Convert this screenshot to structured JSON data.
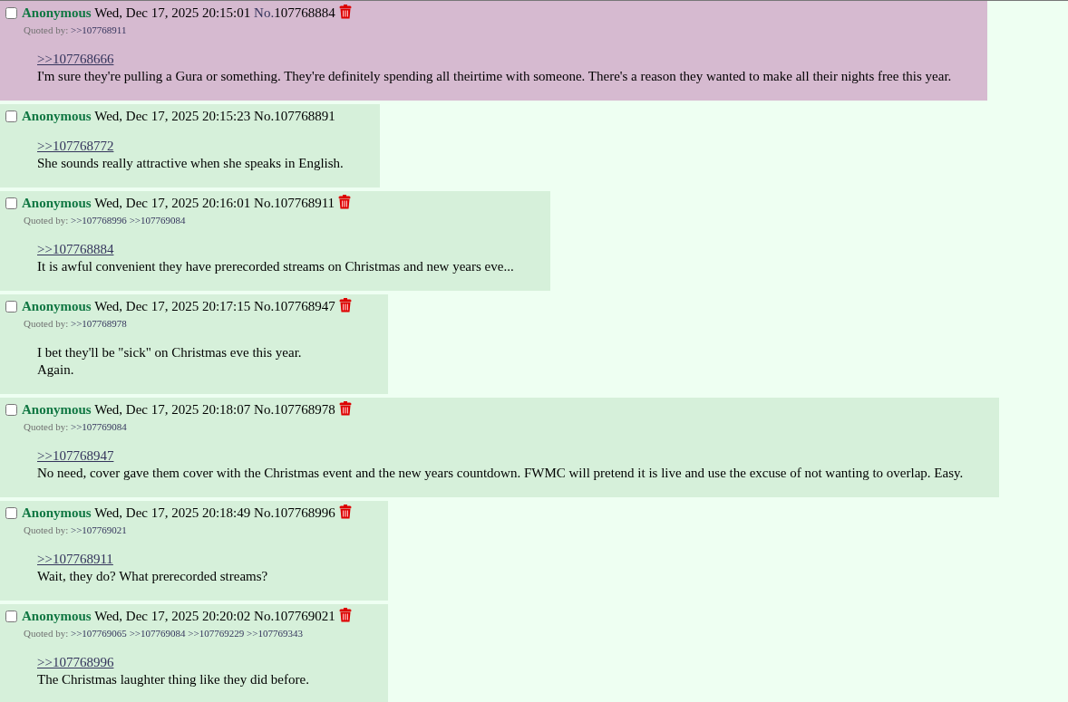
{
  "posts": [
    {
      "selected": false,
      "highlighted": true,
      "name": "Anonymous",
      "datetime": "Wed, Dec 17, 2025 20:15:01",
      "number_label": "No.",
      "number": "107768884",
      "deletable": true,
      "quoted_by_label": "Quoted by:",
      "quoted_by": [
        ">>107768911"
      ],
      "quote_link": ">>107768666",
      "lines": [
        "I'm sure they're pulling a Gura or something. They're definitely spending all theirtime with someone. There's a reason they wanted to make all their nights free this year."
      ]
    },
    {
      "selected": false,
      "highlighted": false,
      "name": "Anonymous",
      "datetime": "Wed, Dec 17, 2025 20:15:23",
      "number_label": "No.",
      "number": "107768891",
      "deletable": false,
      "quote_link": ">>107768772",
      "lines": [
        "She sounds really attractive when she speaks in English."
      ]
    },
    {
      "selected": false,
      "highlighted": false,
      "name": "Anonymous",
      "datetime": "Wed, Dec 17, 2025 20:16:01",
      "number_label": "No.",
      "number": "107768911",
      "deletable": true,
      "quoted_by_label": "Quoted by:",
      "quoted_by": [
        ">>107768996",
        ">>107769084"
      ],
      "quote_link": ">>107768884",
      "lines": [
        "It is awful convenient they have prerecorded streams on Christmas and new years eve..."
      ]
    },
    {
      "selected": false,
      "highlighted": false,
      "name": "Anonymous",
      "datetime": "Wed, Dec 17, 2025 20:17:15",
      "number_label": "No.",
      "number": "107768947",
      "deletable": true,
      "quoted_by_label": "Quoted by:",
      "quoted_by": [
        ">>107768978"
      ],
      "lines": [
        "I bet they'll be \"sick\" on Christmas eve this year.",
        "Again."
      ]
    },
    {
      "selected": false,
      "highlighted": false,
      "name": "Anonymous",
      "datetime": "Wed, Dec 17, 2025 20:18:07",
      "number_label": "No.",
      "number": "107768978",
      "deletable": true,
      "quoted_by_label": "Quoted by:",
      "quoted_by": [
        ">>107769084"
      ],
      "quote_link": ">>107768947",
      "lines": [
        "No need, cover gave them cover with the Christmas event and the new years countdown. FWMC will pretend it is live and use the excuse of not wanting to overlap. Easy."
      ]
    },
    {
      "selected": false,
      "highlighted": false,
      "name": "Anonymous",
      "datetime": "Wed, Dec 17, 2025 20:18:49",
      "number_label": "No.",
      "number": "107768996",
      "deletable": true,
      "quoted_by_label": "Quoted by:",
      "quoted_by": [
        ">>107769021"
      ],
      "quote_link": ">>107768911",
      "lines": [
        "Wait, they do? What prerecorded streams?"
      ]
    },
    {
      "selected": false,
      "highlighted": false,
      "name": "Anonymous",
      "datetime": "Wed, Dec 17, 2025 20:20:02",
      "number_label": "No.",
      "number": "107769021",
      "deletable": true,
      "quoted_by_label": "Quoted by:",
      "quoted_by": [
        ">>107769065",
        ">>107769084",
        ">>107769229",
        ">>107769343"
      ],
      "quote_link": ">>107768996",
      "lines": [
        "The Christmas laughter thing like they did before."
      ]
    }
  ]
}
